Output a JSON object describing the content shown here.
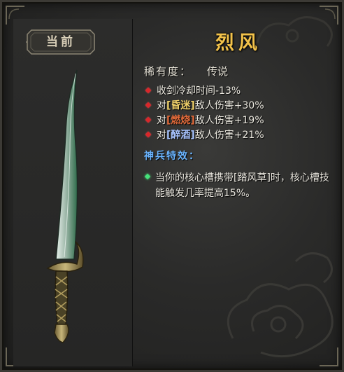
{
  "badge": {
    "label": "当前"
  },
  "item": {
    "name": "烈风",
    "rarity_label": "稀有度：",
    "rarity_value": "传说"
  },
  "stats": [
    {
      "prefix": "收剑冷却时间-13%",
      "keyword": "",
      "suffix": ""
    },
    {
      "prefix": "对",
      "keyword": "[昏迷]",
      "suffix": "敌人伤害+30%"
    },
    {
      "prefix": "对",
      "keyword": "[燃烧]",
      "suffix": "敌人伤害+19%"
    },
    {
      "prefix": "对",
      "keyword": "[醉酒]",
      "suffix": "敌人伤害+21%"
    }
  ],
  "special": {
    "title": "神兵特效：",
    "description": "当你的核心槽携带[踏风草]时，核心槽技能触发几率提高15%。"
  },
  "colors": {
    "title_gold": "#f2c24a",
    "stat_bullet": "#d9262a",
    "special_title": "#6ab4ff",
    "special_bullet": "#46e07a"
  }
}
